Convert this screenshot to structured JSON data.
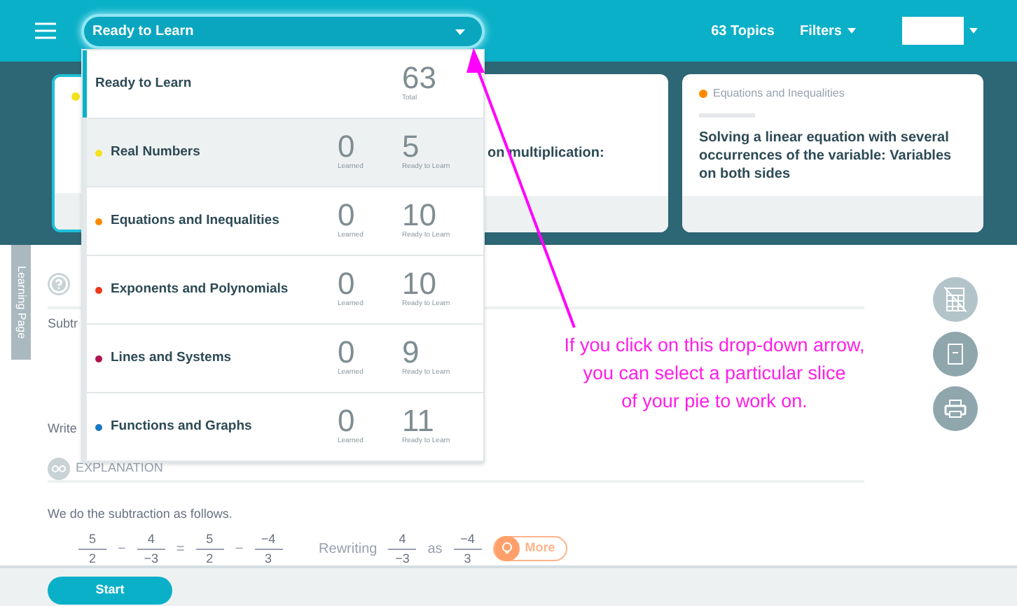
{
  "header": {
    "topic_select": {
      "value": "Ready to Learn"
    },
    "topics_count": "63 Topics",
    "filters": "Filters"
  },
  "cards": [
    {
      "color": "#f2e21c"
    },
    {
      "title": "on multiplication:"
    },
    {
      "color": "#ff8a00",
      "category": "Equations and Inequalities",
      "title": "Solving a linear equation with several occurrences of the variable: Variables on both sides"
    }
  ],
  "side_tab": "Learning Page",
  "lesson": {
    "question_fragment": "Subtr",
    "answer_fragment": "Write",
    "explanation_heading": "EXPLANATION",
    "explanation_text": "We do the subtraction as follows.",
    "equation": [
      {
        "kind": "fraction",
        "num": "5",
        "den": "2"
      },
      {
        "kind": "op",
        "text": "−"
      },
      {
        "kind": "fraction",
        "num": "4",
        "den": "−3"
      },
      {
        "kind": "op",
        "text": "="
      },
      {
        "kind": "fraction",
        "num": "5",
        "den": "2"
      },
      {
        "kind": "op",
        "text": "−"
      },
      {
        "kind": "fraction",
        "num": "−4",
        "den": "3"
      }
    ],
    "hint": [
      {
        "kind": "op",
        "text": "Rewriting"
      },
      {
        "kind": "fraction",
        "num": "4",
        "den": "−3"
      },
      {
        "kind": "op",
        "text": "as"
      },
      {
        "kind": "fraction",
        "num": "−4",
        "den": "3"
      }
    ],
    "more": "More"
  },
  "dropdown": {
    "items": [
      {
        "kind": "total",
        "label": "Ready to Learn",
        "selected": true,
        "highlighted": false,
        "count": "63",
        "count_label": "Total"
      },
      {
        "kind": "topic",
        "label": "Real Numbers",
        "color": "#f2e21c",
        "selected": false,
        "highlighted": true,
        "learned": "0",
        "learned_label": "Learned",
        "ready": "5",
        "ready_label": "Ready to Learn"
      },
      {
        "kind": "topic",
        "label": "Equations and Inequalities",
        "color": "#ff8a00",
        "selected": false,
        "highlighted": false,
        "learned": "0",
        "learned_label": "Learned",
        "ready": "10",
        "ready_label": "Ready to Learn"
      },
      {
        "kind": "topic",
        "label": "Exponents and Polynomials",
        "color": "#f0361c",
        "selected": false,
        "highlighted": false,
        "learned": "0",
        "learned_label": "Learned",
        "ready": "10",
        "ready_label": "Ready to Learn"
      },
      {
        "kind": "topic",
        "label": "Lines and Systems",
        "color": "#b0124e",
        "selected": false,
        "highlighted": false,
        "learned": "0",
        "learned_label": "Learned",
        "ready": "9",
        "ready_label": "Ready to Learn"
      },
      {
        "kind": "topic",
        "label": "Functions and Graphs",
        "color": "#1a78c2",
        "selected": false,
        "highlighted": false,
        "learned": "0",
        "learned_label": "Learned",
        "ready": "11",
        "ready_label": "Ready to Learn"
      }
    ]
  },
  "annotation": "If you click on this drop-down arrow,\nyou can select a particular slice\nof your pie to work on.",
  "footer": {
    "start": "Start"
  }
}
